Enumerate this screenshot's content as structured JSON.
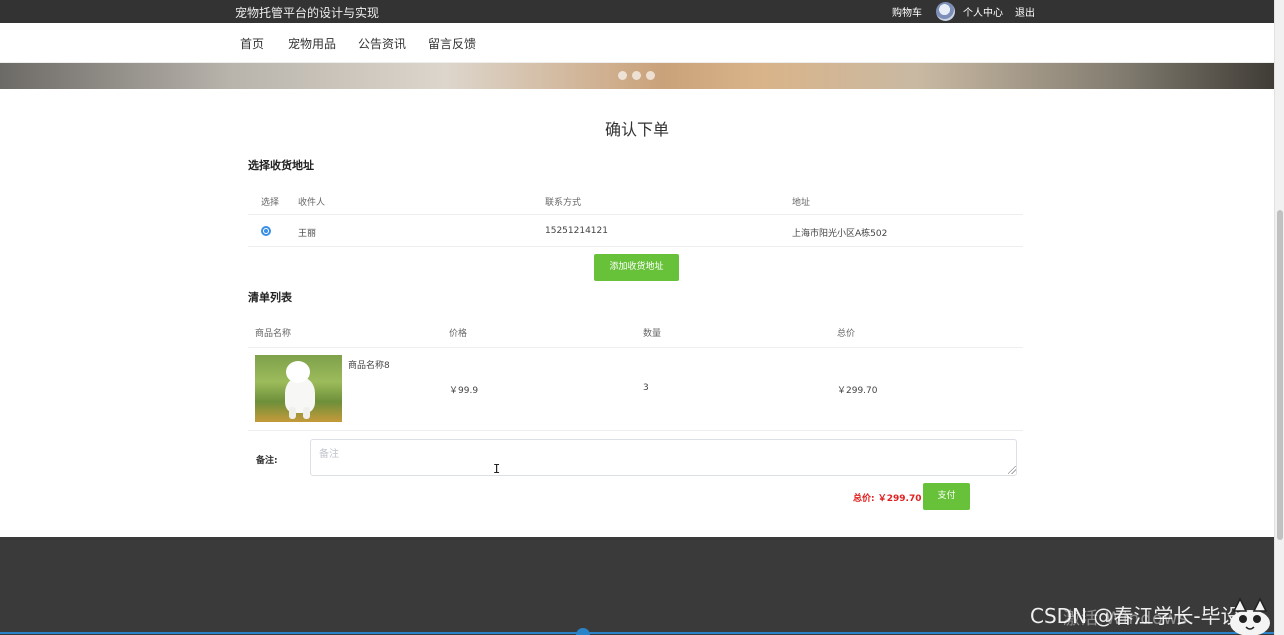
{
  "topbar": {
    "site_title": "宠物托管平台的设计与实现",
    "cart": "购物车",
    "profile": "个人中心",
    "logout": "退出"
  },
  "nav": {
    "items": [
      {
        "label": "首页"
      },
      {
        "label": "宠物用品"
      },
      {
        "label": "公告资讯"
      },
      {
        "label": "留言反馈"
      }
    ]
  },
  "page": {
    "title": "确认下单"
  },
  "address": {
    "section_title": "选择收货地址",
    "headers": {
      "select": "选择",
      "recipient": "收件人",
      "contact": "联系方式",
      "address": "地址"
    },
    "rows": [
      {
        "selected": true,
        "recipient": "王丽",
        "contact": "15251214121",
        "address": "上海市阳光小区A栋502"
      }
    ],
    "add_button": "添加收货地址"
  },
  "order": {
    "section_title": "清单列表",
    "headers": {
      "name": "商品名称",
      "price": "价格",
      "quantity": "数量",
      "total": "总价"
    },
    "items": [
      {
        "name": "商品名称8",
        "price": "￥99.9",
        "quantity": "3",
        "total": "￥299.70"
      }
    ]
  },
  "remark": {
    "label": "备注:",
    "placeholder": "备注",
    "value": ""
  },
  "summary": {
    "total_text": "总价: ￥299.70",
    "pay_button": "支付"
  },
  "watermarks": {
    "activate": "激活 Windows",
    "csdn": "CSDN @春江学长-毕设"
  },
  "colors": {
    "accent_green": "#67c23a",
    "total_red": "#e02020",
    "topbar": "#333333",
    "footer": "#3a3a3a",
    "radio_blue": "#3b8fe6"
  }
}
